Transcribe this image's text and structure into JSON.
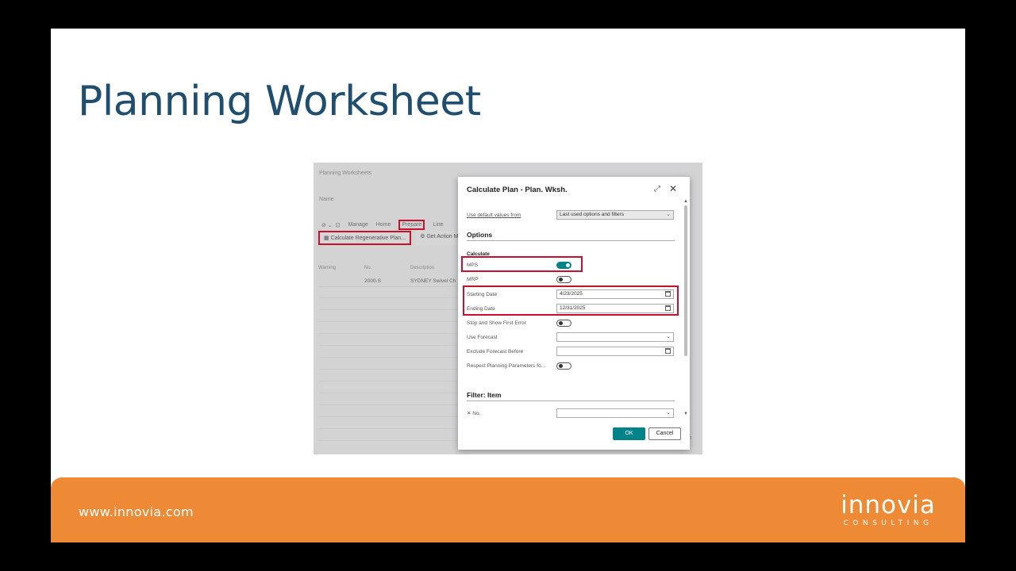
{
  "slide": {
    "title": "Planning Worksheet",
    "footer_url": "www.innovia.com",
    "logo_word": "innovia",
    "logo_sub": "CONSULTING"
  },
  "background": {
    "page_title": "Planning Worksheets",
    "name_label": "Name",
    "tabs": [
      "Manage",
      "Home",
      "Prepare",
      "Line"
    ],
    "actions": [
      "Calculate Regenerative Plan...",
      "Get Action Me"
    ],
    "grid_headers": [
      "Warning",
      "No.",
      "Description"
    ],
    "grid_row": {
      "no": "2000-S",
      "description": "SYDNEY Swivel Ch"
    },
    "right_fragment": "tion"
  },
  "dialog": {
    "title": "Calculate Plan - Plan. Wksh.",
    "use_default_label": "Use default values from",
    "use_default_value": "Last used options and filters",
    "options_section": "Options",
    "calculate_group": "Calculate",
    "mps_label": "MPS",
    "mps_on": true,
    "mrp_label": "MRP",
    "mrp_on": false,
    "starting_date_label": "Starting Date",
    "starting_date_value": "4/23/2025",
    "ending_date_label": "Ending Date",
    "ending_date_value": "12/31/2025",
    "stop_label": "Stop and Show First Error",
    "use_forecast_label": "Use Forecast",
    "exclude_forecast_label": "Exclude Forecast Before",
    "respect_label": "Respect Planning Parameters fo...",
    "filter_section": "Filter: Item",
    "no_filter_label": "No.",
    "ok_label": "OK",
    "cancel_label": "Cancel"
  },
  "colors": {
    "title": "#1f4e6e",
    "footer": "#ee8a35",
    "highlight": "#c8102e",
    "accent": "#008489"
  }
}
